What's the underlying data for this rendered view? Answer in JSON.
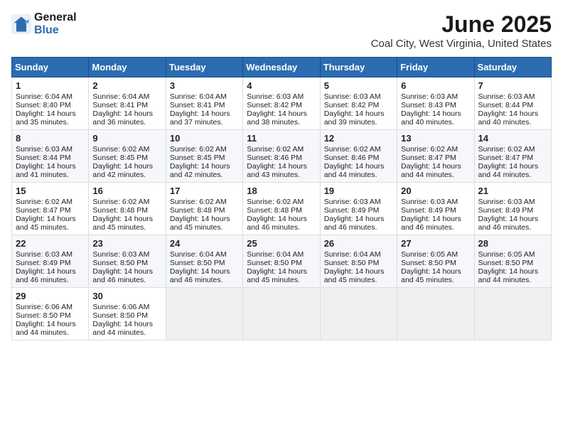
{
  "header": {
    "logo_general": "General",
    "logo_blue": "Blue",
    "title": "June 2025",
    "location": "Coal City, West Virginia, United States"
  },
  "weekdays": [
    "Sunday",
    "Monday",
    "Tuesday",
    "Wednesday",
    "Thursday",
    "Friday",
    "Saturday"
  ],
  "weeks": [
    [
      {
        "day": "1",
        "info": "Sunrise: 6:04 AM\nSunset: 8:40 PM\nDaylight: 14 hours and 35 minutes."
      },
      {
        "day": "2",
        "info": "Sunrise: 6:04 AM\nSunset: 8:41 PM\nDaylight: 14 hours and 36 minutes."
      },
      {
        "day": "3",
        "info": "Sunrise: 6:04 AM\nSunset: 8:41 PM\nDaylight: 14 hours and 37 minutes."
      },
      {
        "day": "4",
        "info": "Sunrise: 6:03 AM\nSunset: 8:42 PM\nDaylight: 14 hours and 38 minutes."
      },
      {
        "day": "5",
        "info": "Sunrise: 6:03 AM\nSunset: 8:42 PM\nDaylight: 14 hours and 39 minutes."
      },
      {
        "day": "6",
        "info": "Sunrise: 6:03 AM\nSunset: 8:43 PM\nDaylight: 14 hours and 40 minutes."
      },
      {
        "day": "7",
        "info": "Sunrise: 6:03 AM\nSunset: 8:44 PM\nDaylight: 14 hours and 40 minutes."
      }
    ],
    [
      {
        "day": "8",
        "info": "Sunrise: 6:03 AM\nSunset: 8:44 PM\nDaylight: 14 hours and 41 minutes."
      },
      {
        "day": "9",
        "info": "Sunrise: 6:02 AM\nSunset: 8:45 PM\nDaylight: 14 hours and 42 minutes."
      },
      {
        "day": "10",
        "info": "Sunrise: 6:02 AM\nSunset: 8:45 PM\nDaylight: 14 hours and 42 minutes."
      },
      {
        "day": "11",
        "info": "Sunrise: 6:02 AM\nSunset: 8:46 PM\nDaylight: 14 hours and 43 minutes."
      },
      {
        "day": "12",
        "info": "Sunrise: 6:02 AM\nSunset: 8:46 PM\nDaylight: 14 hours and 44 minutes."
      },
      {
        "day": "13",
        "info": "Sunrise: 6:02 AM\nSunset: 8:47 PM\nDaylight: 14 hours and 44 minutes."
      },
      {
        "day": "14",
        "info": "Sunrise: 6:02 AM\nSunset: 8:47 PM\nDaylight: 14 hours and 44 minutes."
      }
    ],
    [
      {
        "day": "15",
        "info": "Sunrise: 6:02 AM\nSunset: 8:47 PM\nDaylight: 14 hours and 45 minutes."
      },
      {
        "day": "16",
        "info": "Sunrise: 6:02 AM\nSunset: 8:48 PM\nDaylight: 14 hours and 45 minutes."
      },
      {
        "day": "17",
        "info": "Sunrise: 6:02 AM\nSunset: 8:48 PM\nDaylight: 14 hours and 45 minutes."
      },
      {
        "day": "18",
        "info": "Sunrise: 6:02 AM\nSunset: 8:48 PM\nDaylight: 14 hours and 46 minutes."
      },
      {
        "day": "19",
        "info": "Sunrise: 6:03 AM\nSunset: 8:49 PM\nDaylight: 14 hours and 46 minutes."
      },
      {
        "day": "20",
        "info": "Sunrise: 6:03 AM\nSunset: 8:49 PM\nDaylight: 14 hours and 46 minutes."
      },
      {
        "day": "21",
        "info": "Sunrise: 6:03 AM\nSunset: 8:49 PM\nDaylight: 14 hours and 46 minutes."
      }
    ],
    [
      {
        "day": "22",
        "info": "Sunrise: 6:03 AM\nSunset: 8:49 PM\nDaylight: 14 hours and 46 minutes."
      },
      {
        "day": "23",
        "info": "Sunrise: 6:03 AM\nSunset: 8:50 PM\nDaylight: 14 hours and 46 minutes."
      },
      {
        "day": "24",
        "info": "Sunrise: 6:04 AM\nSunset: 8:50 PM\nDaylight: 14 hours and 46 minutes."
      },
      {
        "day": "25",
        "info": "Sunrise: 6:04 AM\nSunset: 8:50 PM\nDaylight: 14 hours and 45 minutes."
      },
      {
        "day": "26",
        "info": "Sunrise: 6:04 AM\nSunset: 8:50 PM\nDaylight: 14 hours and 45 minutes."
      },
      {
        "day": "27",
        "info": "Sunrise: 6:05 AM\nSunset: 8:50 PM\nDaylight: 14 hours and 45 minutes."
      },
      {
        "day": "28",
        "info": "Sunrise: 6:05 AM\nSunset: 8:50 PM\nDaylight: 14 hours and 44 minutes."
      }
    ],
    [
      {
        "day": "29",
        "info": "Sunrise: 6:06 AM\nSunset: 8:50 PM\nDaylight: 14 hours and 44 minutes."
      },
      {
        "day": "30",
        "info": "Sunrise: 6:06 AM\nSunset: 8:50 PM\nDaylight: 14 hours and 44 minutes."
      },
      {
        "day": "",
        "info": ""
      },
      {
        "day": "",
        "info": ""
      },
      {
        "day": "",
        "info": ""
      },
      {
        "day": "",
        "info": ""
      },
      {
        "day": "",
        "info": ""
      }
    ]
  ]
}
